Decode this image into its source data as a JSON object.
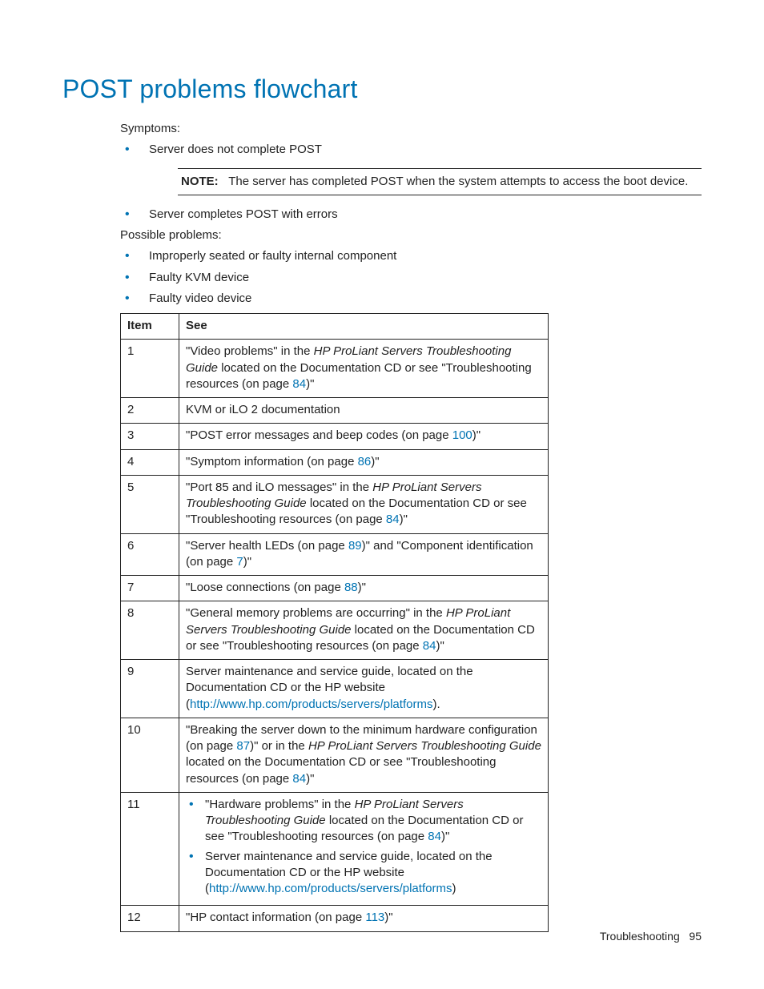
{
  "heading": "POST problems flowchart",
  "symptoms_label": "Symptoms:",
  "symptoms": [
    "Server does not complete POST",
    "Server completes POST with errors"
  ],
  "note": {
    "label": "NOTE:",
    "text": "The server has completed POST when the system attempts to access the boot device."
  },
  "possible_label": "Possible problems:",
  "possible": [
    "Improperly seated or faulty internal component",
    "Faulty KVM device",
    "Faulty video device"
  ],
  "table": {
    "head_item": "Item",
    "head_see": "See",
    "rows": {
      "r1": {
        "item": "1"
      },
      "r2": {
        "item": "2",
        "see": "KVM or iLO 2 documentation"
      },
      "r3": {
        "item": "3"
      },
      "r4": {
        "item": "4"
      },
      "r5": {
        "item": "5"
      },
      "r6": {
        "item": "6"
      },
      "r7": {
        "item": "7"
      },
      "r8": {
        "item": "8"
      },
      "r9": {
        "item": "9"
      },
      "r10": {
        "item": "10"
      },
      "r11": {
        "item": "11"
      },
      "r12": {
        "item": "12"
      }
    }
  },
  "text": {
    "r1_a": "\"Video problems\" in the ",
    "r1_i": "HP ProLiant Servers Troubleshooting Guide",
    "r1_b": " located on the Documentation CD or see \"Troubleshooting resources (on page ",
    "r1_link": "84",
    "r1_c": ")\"",
    "r3_a": "\"POST error messages and beep codes (on page ",
    "r3_link": "100",
    "r3_b": ")\"",
    "r4_a": "\"Symptom information (on page ",
    "r4_link": "86",
    "r4_b": ")\"",
    "r5_a": "\"Port 85 and iLO messages\" in the ",
    "r5_i": "HP ProLiant Servers Troubleshooting Guide",
    "r5_b": " located on the Documentation CD or see \"Troubleshooting resources (on page ",
    "r5_link": "84",
    "r5_c": ")\"",
    "r6_a": "\"Server health LEDs (on page ",
    "r6_link1": "89",
    "r6_b": ")\" and \"Component identification (on page ",
    "r6_link2": "7",
    "r6_c": ")\"",
    "r7_a": "\"Loose connections (on page ",
    "r7_link": "88",
    "r7_b": ")\"",
    "r8_a": "\"General memory problems are occurring\" in the ",
    "r8_i": "HP ProLiant Servers Troubleshooting Guide",
    "r8_b": " located on the Documentation CD or see \"Troubleshooting resources (on page ",
    "r8_link": "84",
    "r8_c": ")\"",
    "r9_a": "Server maintenance and service guide, located on the Documentation CD or the HP website (",
    "r9_link": "http://www.hp.com/products/servers/platforms",
    "r9_b": ").",
    "r10_a": "\"Breaking the server down to the minimum hardware configuration (on page ",
    "r10_link1": "87",
    "r10_b": ")\" or in the ",
    "r10_i": "HP ProLiant Servers Troubleshooting Guide",
    "r10_c": " located on the Documentation CD or see \"Troubleshooting resources (on page ",
    "r10_link2": "84",
    "r10_d": ")\"",
    "r11_1a": "\"Hardware problems\" in the ",
    "r11_1i": "HP ProLiant Servers Troubleshooting Guide",
    "r11_1b": " located on the Documentation CD or see \"Troubleshooting resources (on page ",
    "r11_1link": "84",
    "r11_1c": ")\"",
    "r11_2a": "Server maintenance and service guide, located on the Documentation CD or the HP website (",
    "r11_2link": "http://www.hp.com/products/servers/platforms",
    "r11_2b": ")",
    "r12_a": "\"HP contact information (on page ",
    "r12_link": "113",
    "r12_b": ")\""
  },
  "footer": {
    "section": "Troubleshooting",
    "page": "95"
  }
}
